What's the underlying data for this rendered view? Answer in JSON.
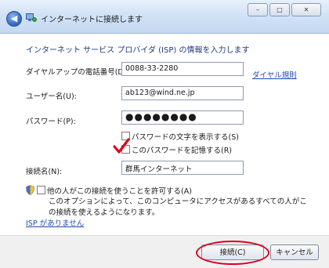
{
  "window": {
    "title": "インターネットに接続します",
    "back_icon": "back-arrow-icon",
    "controls": {
      "minimize": "–",
      "maximize": "□",
      "close": "✕"
    }
  },
  "form": {
    "heading": "インターネット サービス プロバイダ (ISP) の情報を入力します",
    "dialup_label": "ダイヤルアップの電話番号(D):",
    "dialup_value": "0088-33-2280",
    "dialing_rules_link": "ダイヤル規則",
    "username_label": "ユーザー名(U):",
    "username_value": "ab123@wind.ne.jp",
    "password_label": "パスワード(P):",
    "password_value": "●●●●●●●●",
    "show_password_label": "パスワードの文字を表示する(S)",
    "remember_password_label": "このパスワードを記憶する(R)",
    "connection_name_label": "接続名(N):",
    "connection_name_value": "群馬インターネット",
    "allow_others_label": "他の人がこの接続を使うことを許可する(A)",
    "allow_others_note": "このオプションによって、このコンピュータにアクセスがあるすべての人がこの接続を使えるようになります。",
    "no_isp_link": "ISP がありません"
  },
  "buttons": {
    "connect": "接続(C)",
    "cancel": "キャンセル"
  },
  "colors": {
    "heading": "#1d3a87",
    "link": "#1b4fae",
    "annotation": "#e2001a"
  }
}
